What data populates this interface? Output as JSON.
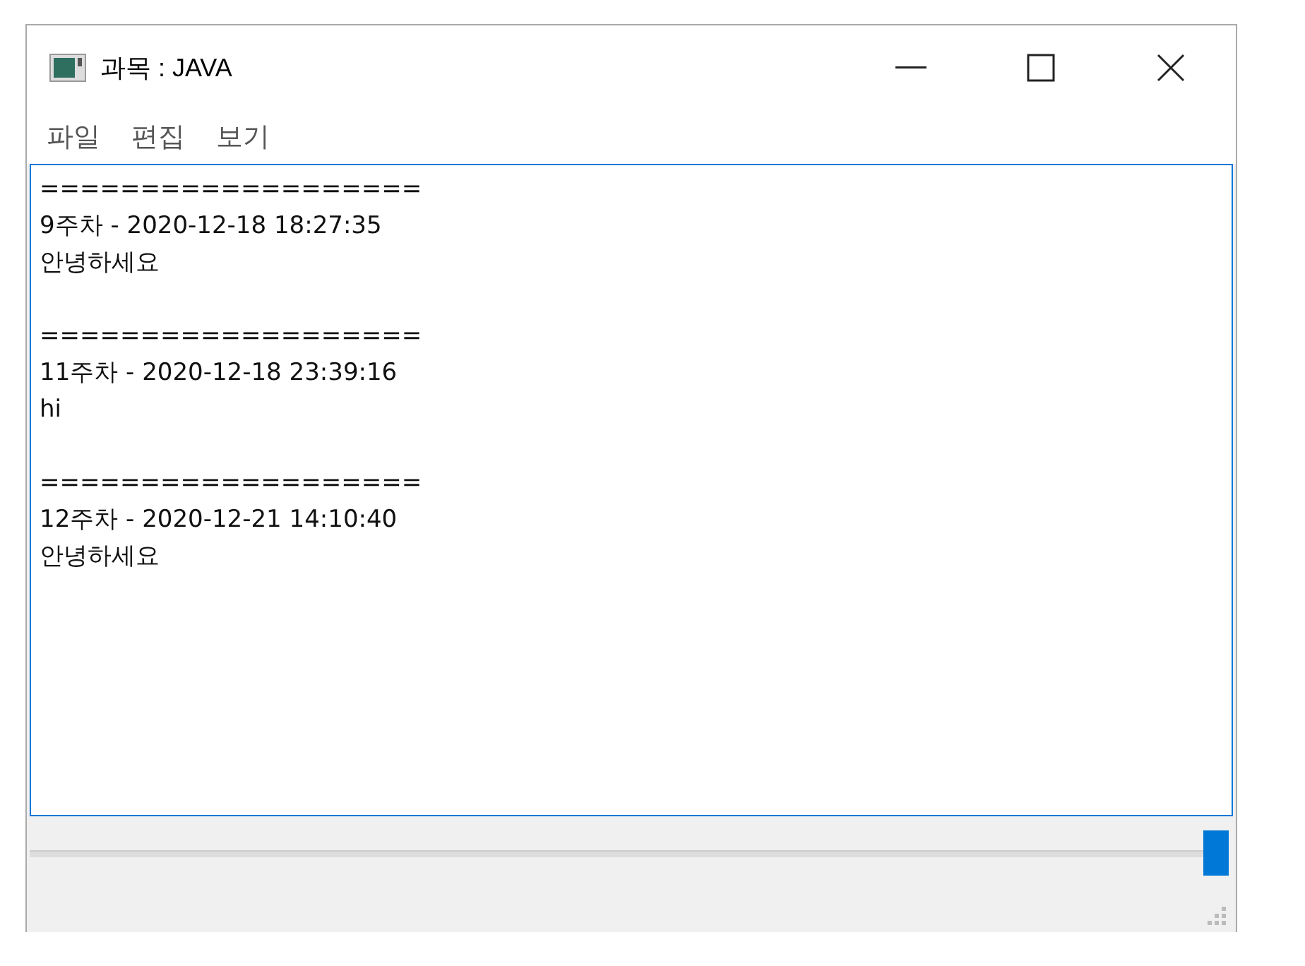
{
  "window": {
    "title": "과목 : JAVA"
  },
  "menu": [
    {
      "label": "파일"
    },
    {
      "label": "편집"
    },
    {
      "label": "보기"
    }
  ],
  "entries": [
    {
      "separator": "===================",
      "heading": "9주차 - 2020-12-18 18:27:35",
      "body": "안녕하세요"
    },
    {
      "separator": "===================",
      "heading": "11주차 - 2020-12-18 23:39:16",
      "body": "hi"
    },
    {
      "separator": "===================",
      "heading": "12주차 - 2020-12-21 14:10:40",
      "body": "안녕하세요"
    }
  ],
  "slider": {
    "level": 1
  }
}
